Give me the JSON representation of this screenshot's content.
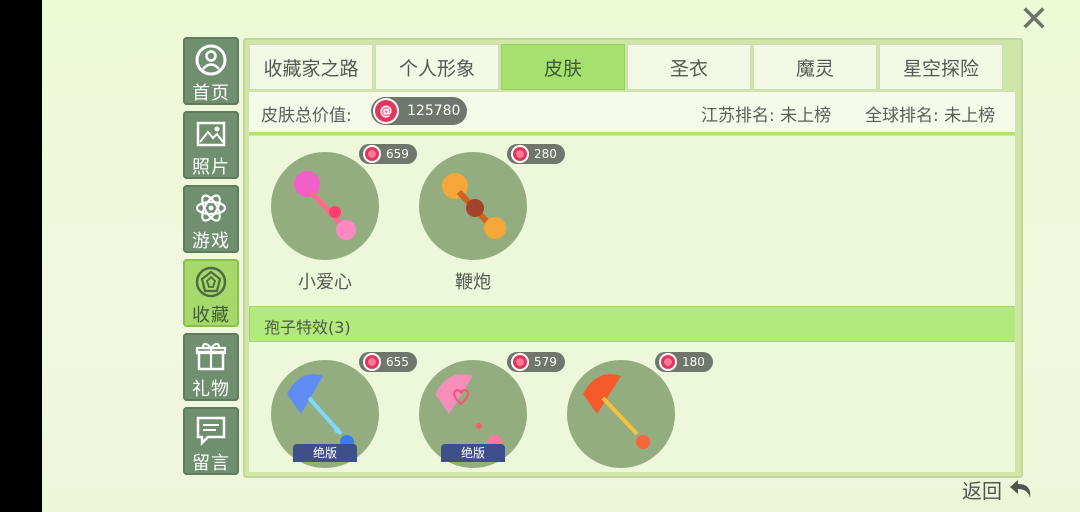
{
  "nav": [
    {
      "label": "首页",
      "icon": "user-circle-icon"
    },
    {
      "label": "照片",
      "icon": "photo-icon"
    },
    {
      "label": "游戏",
      "icon": "atom-icon"
    },
    {
      "label": "收藏",
      "icon": "gem-icon",
      "active": true
    },
    {
      "label": "礼物",
      "icon": "gift-icon"
    },
    {
      "label": "留言",
      "icon": "message-icon"
    }
  ],
  "tabs": [
    {
      "label": "收藏家之路"
    },
    {
      "label": "个人形象"
    },
    {
      "label": "皮肤",
      "active": true
    },
    {
      "label": "圣衣"
    },
    {
      "label": "魔灵"
    },
    {
      "label": "星空探险"
    }
  ],
  "summary": {
    "total_label": "皮肤总价值:",
    "total_value": "125780",
    "jiangsu_rank": "江苏排名: 未上榜",
    "global_rank": "全球排名: 未上榜"
  },
  "skins": [
    {
      "name": "小爱心",
      "price": "659"
    },
    {
      "name": "鞭炮",
      "price": "280"
    }
  ],
  "spore_section": {
    "title": "孢子特效(3)"
  },
  "spores": [
    {
      "price": "655",
      "badge": "绝版"
    },
    {
      "price": "579",
      "badge": "绝版"
    },
    {
      "price": "180",
      "badge": ""
    }
  ],
  "back_label": "返回",
  "colors": {
    "accent_green": "#a8e070",
    "nav_gray_green": "#6f8f6f",
    "coin_pink": "#e0385d"
  }
}
